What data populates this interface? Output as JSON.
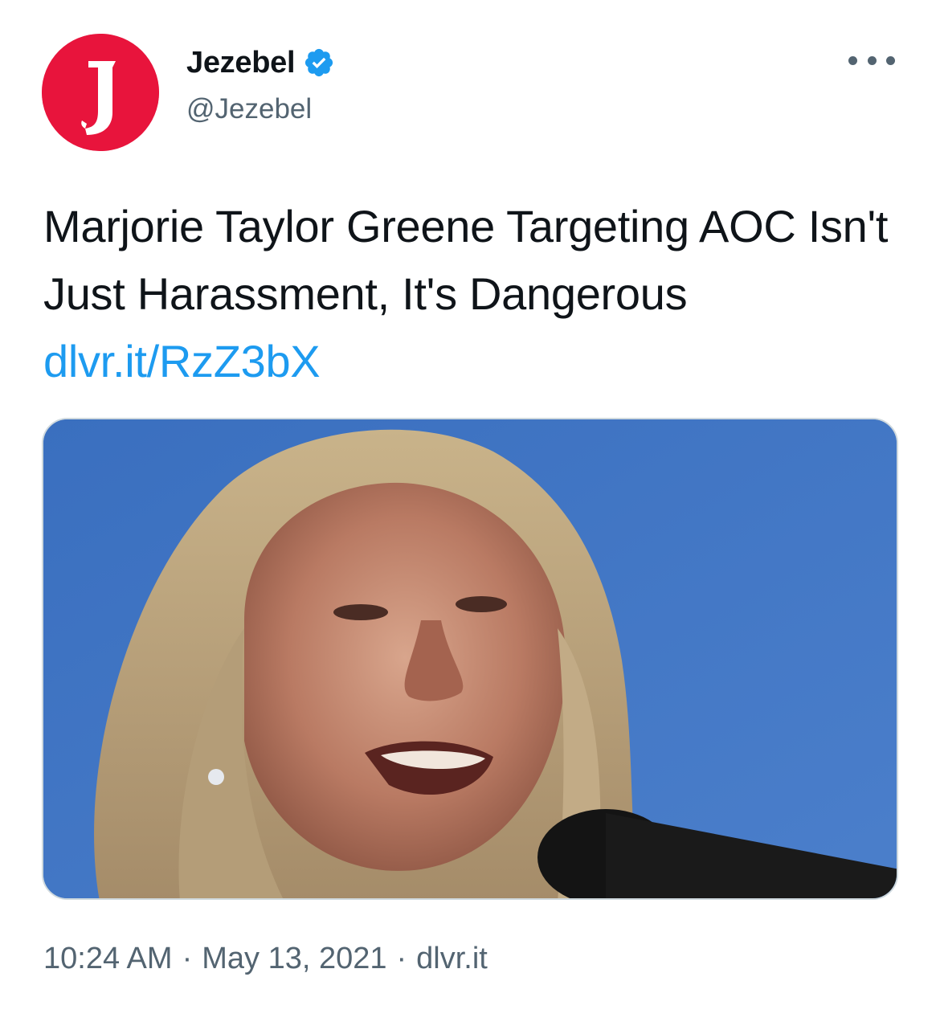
{
  "author": {
    "display_name": "Jezebel",
    "handle": "@Jezebel",
    "avatar_letter": "J",
    "avatar_color": "#e8143c",
    "verified": true,
    "verified_color": "#1d9bf0"
  },
  "tweet": {
    "text": "Marjorie Taylor Greene Targeting AOC Isn't Just Harassment, It's Dangerous",
    "link": "dlvr.it/RzZ3bX",
    "link_color": "#1d9bf0"
  },
  "meta": {
    "time": "10:24 AM",
    "date": "May 13, 2021",
    "source": "dlvr.it",
    "separator": "·"
  },
  "icons": {
    "more": "more-options-icon",
    "verified": "verified-badge-icon"
  }
}
